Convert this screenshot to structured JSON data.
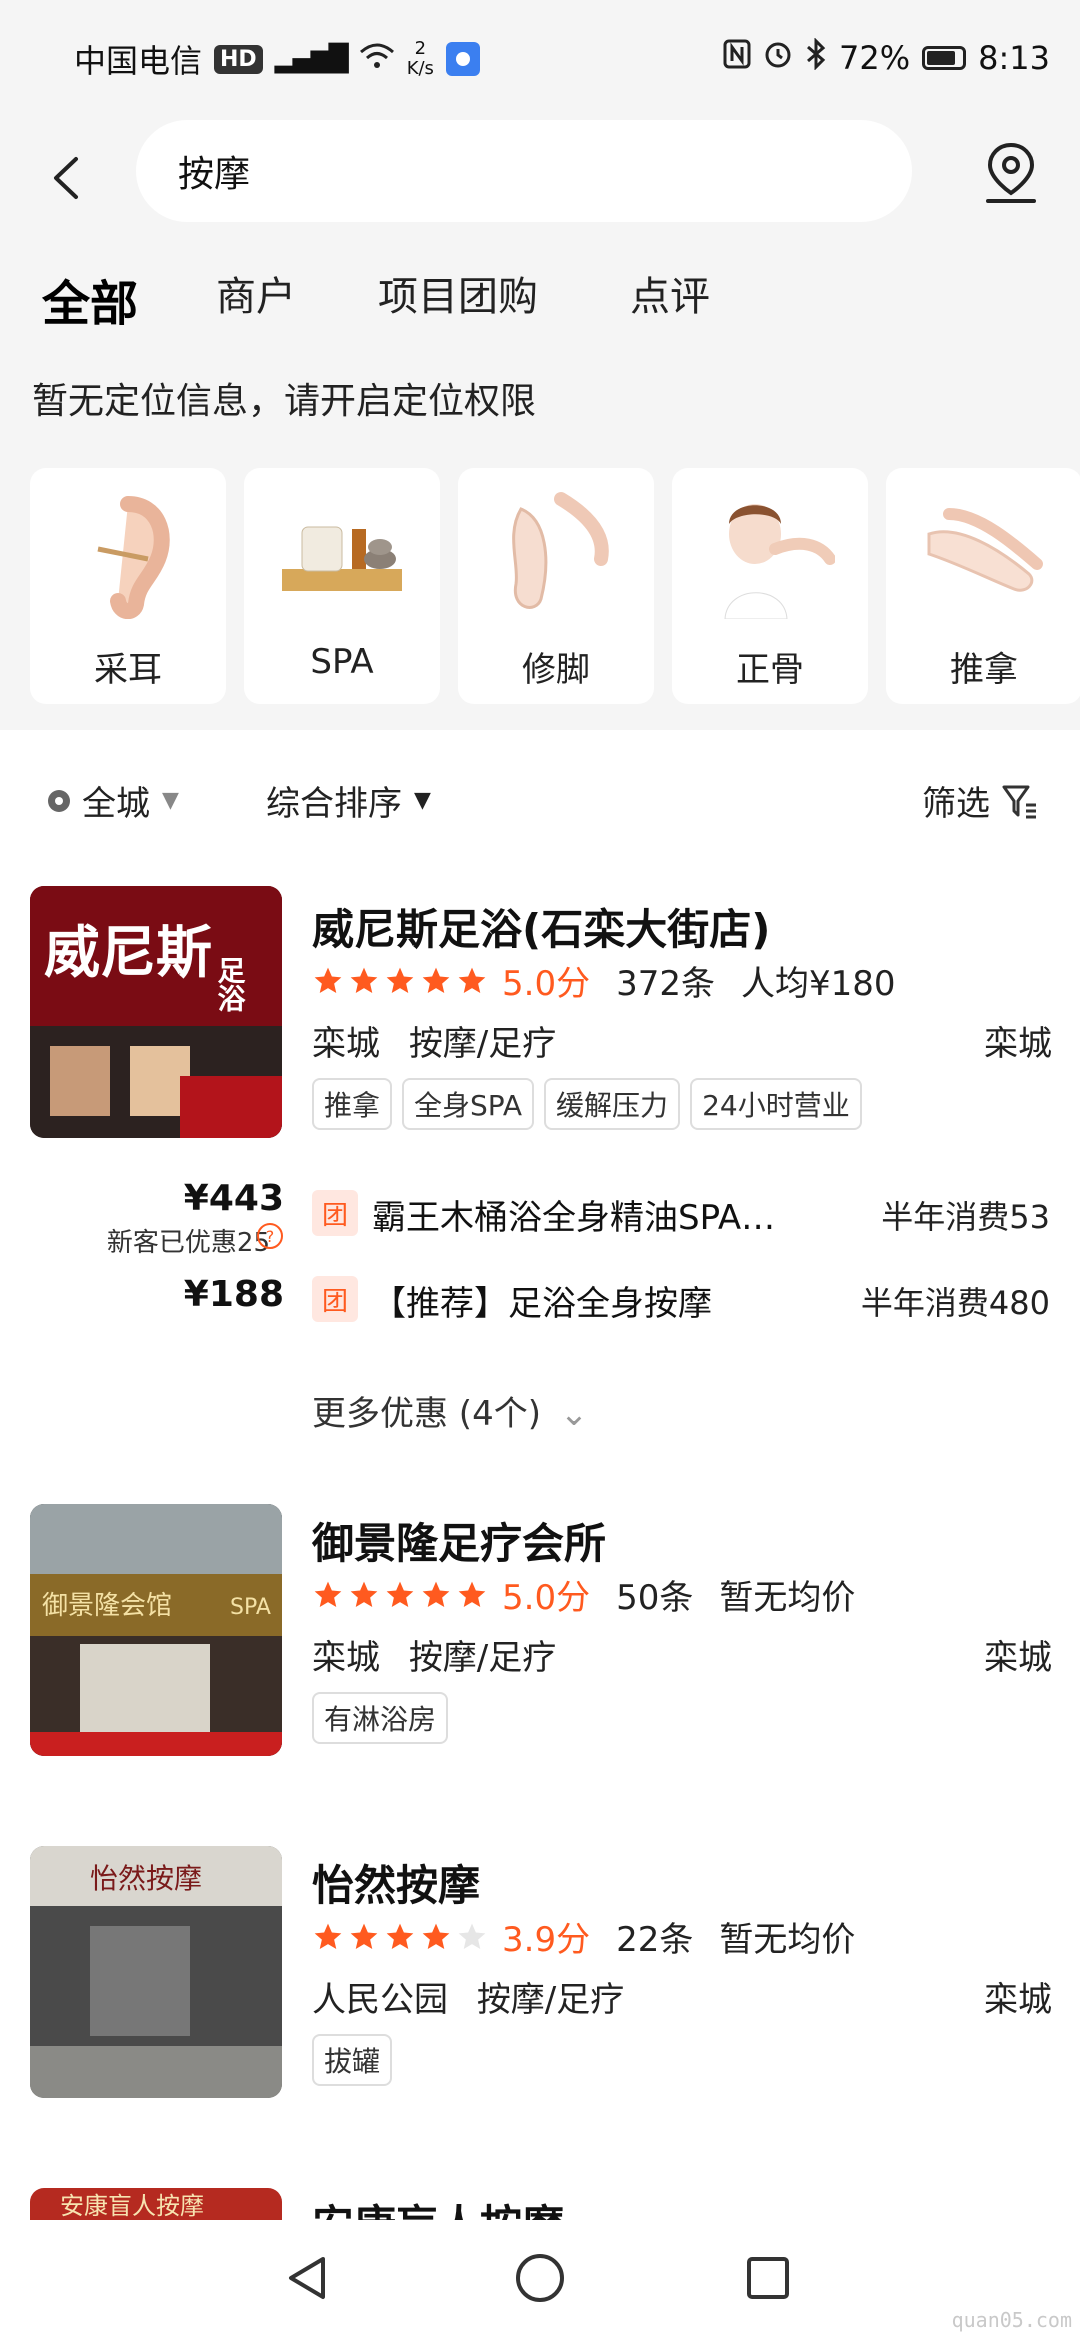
{
  "status_bar": {
    "carrier": "中国电信",
    "hd": "HD",
    "net_speed_value": "2",
    "net_speed_unit": "K/s",
    "battery": "72%",
    "time": "8:13"
  },
  "search": {
    "query": "按摩"
  },
  "tabs": [
    {
      "label": "全部"
    },
    {
      "label": "商户"
    },
    {
      "label": "项目团购"
    },
    {
      "label": "点评"
    }
  ],
  "location_hint": "暂无定位信息，请开启定位权限",
  "categories": [
    {
      "label": "采耳"
    },
    {
      "label": "SPA"
    },
    {
      "label": "修脚"
    },
    {
      "label": "正骨"
    },
    {
      "label": "推拿"
    }
  ],
  "filters": {
    "city": "全城",
    "sort": "综合排序",
    "filter": "筛选"
  },
  "shops": [
    {
      "name": "威尼斯足浴(石栾大街店)",
      "rating": 5.0,
      "score": "5.0分",
      "reviews": "372条",
      "avg": "人均¥180",
      "district": "栾城",
      "category": "按摩/足疗",
      "area": "栾城",
      "tags": [
        "推拿",
        "全身SPA",
        "缓解压力",
        "24小时营业"
      ],
      "sign_text": "威尼斯",
      "sign_text2": "足浴",
      "deals": [
        {
          "price": "¥443",
          "sub": "新客已优惠25",
          "title": "霸王木桶浴全身精油SPA（搓...",
          "sales": "半年消费53"
        },
        {
          "price": "¥188",
          "sub": "",
          "title": "【推荐】足浴全身按摩",
          "sales": "半年消费480"
        }
      ],
      "more": "更多优惠 (4个)"
    },
    {
      "name": "御景隆足疗会所",
      "rating": 5.0,
      "score": "5.0分",
      "reviews": "50条",
      "avg": "暂无均价",
      "district": "栾城",
      "category": "按摩/足疗",
      "area": "栾城",
      "tags": [
        "有淋浴房"
      ],
      "sign_text": "御景隆会馆",
      "sign_text2": "SPA"
    },
    {
      "name": "怡然按摩",
      "rating": 3.9,
      "score": "3.9分",
      "reviews": "22条",
      "avg": "暂无均价",
      "district": "人民公园",
      "category": "按摩/足疗",
      "area": "栾城",
      "tags": [
        "拔罐"
      ],
      "sign_text": "怡然按摩"
    },
    {
      "name": "安康盲人按摩",
      "sign_text": "安康盲人按摩"
    }
  ],
  "watermark": "quan05.com",
  "colors": {
    "accent": "#ff5a1f",
    "tab_underline": "#ffc21a",
    "background": "#f5f5f5"
  }
}
